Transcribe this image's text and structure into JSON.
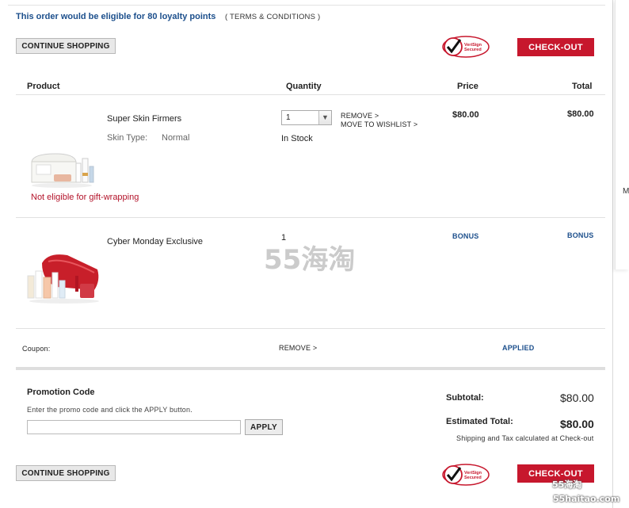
{
  "loyalty": {
    "message": "This order would be eligible for 80 loyalty points",
    "terms_link": "( TERMS & CONDITIONS )"
  },
  "buttons": {
    "continue_shopping": "CONTINUE SHOPPING",
    "checkout": "CHECK-OUT",
    "apply": "APPLY"
  },
  "verisign": {
    "line1": "VeriSign",
    "line2": "Secured"
  },
  "table_headers": {
    "product": "Product",
    "quantity": "Quantity",
    "price": "Price",
    "total": "Total"
  },
  "items": [
    {
      "name": "Super Skin Firmers",
      "attr_label": "Skin Type:",
      "attr_value": "Normal",
      "quantity": "1",
      "stock": "In Stock",
      "remove": "REMOVE >",
      "wishlist": "MOVE TO WISHLIST >",
      "price": "$80.00",
      "total": "$80.00",
      "note": "Not eligible for gift-wrapping"
    },
    {
      "name": "Cyber Monday Exclusive",
      "quantity": "1",
      "price": "BONUS",
      "total": "BONUS"
    }
  ],
  "coupon": {
    "label": "Coupon:",
    "remove": "REMOVE >",
    "status": "APPLIED"
  },
  "promo": {
    "title": "Promotion Code",
    "hint": "Enter the promo code and click the APPLY button.",
    "value": "",
    "placeholder": ""
  },
  "summary": {
    "subtotal_label": "Subtotal:",
    "subtotal_value": "$80.00",
    "estimated_label": "Estimated Total:",
    "estimated_value": "$80.00",
    "note": "Shipping and Tax calculated at Check-out"
  },
  "side": {
    "letter": "M"
  },
  "watermark": {
    "center": "55海淘",
    "corner_line1": "55海淘",
    "corner_line2": "55haitao.com"
  },
  "colors": {
    "accent_blue": "#1c4f8c",
    "checkout_red": "#c7172d",
    "warning_red": "#b3132a"
  }
}
